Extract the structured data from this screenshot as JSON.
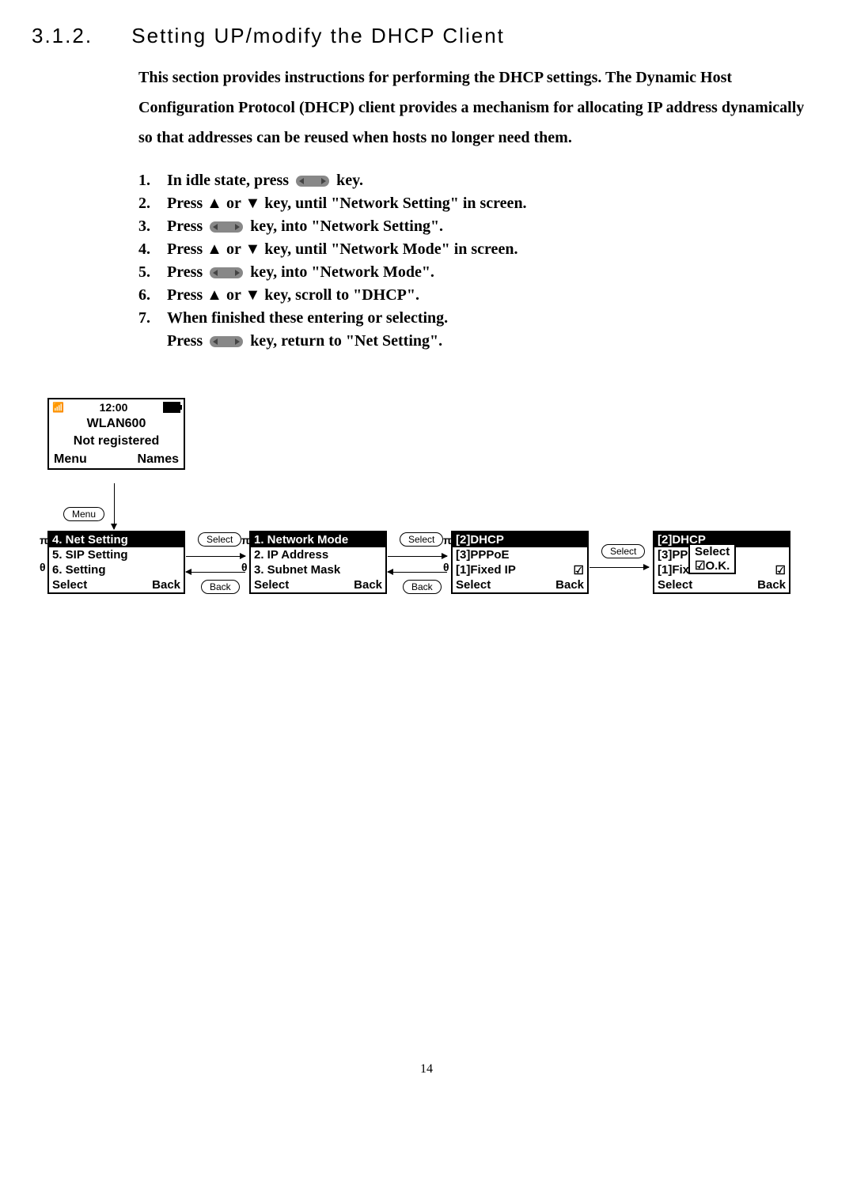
{
  "heading": {
    "num": "3.1.2.",
    "title": "Setting UP/modify the DHCP Client"
  },
  "intro": "This section provides instructions for performing the DHCP settings. The Dynamic Host Configuration Protocol (DHCP) client provides a mechanism for allocating IP address dynamically so that addresses can be reused when hosts no longer need them.",
  "steps": [
    {
      "n": "1.",
      "pre": "In idle state, press ",
      "key": true,
      "post": " key."
    },
    {
      "n": "2.",
      "pre": "Press ▲ or ▼ key, until \"Network Setting\" in screen.",
      "key": false,
      "post": ""
    },
    {
      "n": "3.",
      "pre": "Press ",
      "key": true,
      "post": " key, into \"Network Setting\"."
    },
    {
      "n": "4.",
      "pre": "Press ▲ or ▼ key, until \"Network Mode\" in screen.",
      "key": false,
      "post": ""
    },
    {
      "n": "5.",
      "pre": "Press ",
      "key": true,
      "post": " key, into \"Network Mode\"."
    },
    {
      "n": "6.",
      "pre": "Press ▲ or ▼ key, scroll to \"DHCP\".",
      "key": false,
      "post": ""
    },
    {
      "n": "7.",
      "pre": "When finished these entering or selecting.",
      "key": false,
      "post": ""
    }
  ],
  "step7b": {
    "pre": "Press ",
    "post": " key, return to \"Net Setting\"."
  },
  "idle": {
    "time": "12:00",
    "name": "WLAN600",
    "status": "Not registered",
    "left": "Menu",
    "right": "Names"
  },
  "s1": {
    "l1": "4. Net Setting",
    "l2": "5. SIP Setting",
    "l3": "6. Setting",
    "left": "Select",
    "right": "Back"
  },
  "s2": {
    "l1": "1. Network Mode",
    "l2": "2. IP Address",
    "l3": "3. Subnet Mask",
    "left": "Select",
    "right": "Back"
  },
  "s3": {
    "l1": "[2]DHCP",
    "l2": "[3]PPPoE",
    "l3": "[1]Fixed IP",
    "left": "Select",
    "right": "Back"
  },
  "s4": {
    "l1": "[2]DHCP",
    "l2": "[3]PPPoE",
    "l3": "[1]Fixed IP",
    "left": "Select",
    "right": "Back",
    "popup1": "Select",
    "popup2": "☑O.K."
  },
  "btns": {
    "menu": "Menu",
    "select": "Select",
    "back": "Back"
  },
  "check": "☑",
  "pi": "π",
  "theta": "θ",
  "page": "14"
}
